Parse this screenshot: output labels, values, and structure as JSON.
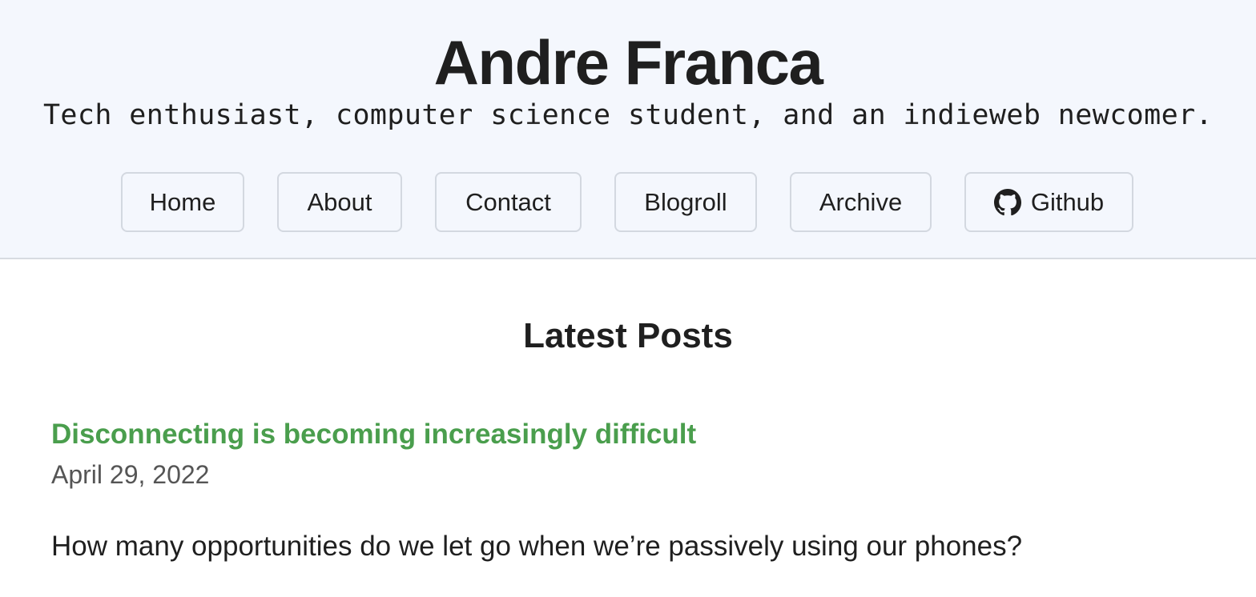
{
  "header": {
    "title": "Andre Franca",
    "tagline": "Tech enthusiast, computer science student, and an indieweb newcomer."
  },
  "nav": {
    "items": [
      {
        "label": "Home"
      },
      {
        "label": "About"
      },
      {
        "label": "Contact"
      },
      {
        "label": "Blogroll"
      },
      {
        "label": "Archive"
      },
      {
        "label": "Github",
        "icon": "github-icon"
      }
    ]
  },
  "main": {
    "section_title": "Latest Posts",
    "posts": [
      {
        "title": "Disconnecting is becoming increasingly difficult",
        "date": "April 29, 2022",
        "excerpt": "How many opportunities do we let go when we’re passively using our phones?"
      }
    ]
  },
  "colors": {
    "header_bg": "#f4f7fd",
    "link_green": "#4a9e4d",
    "border": "#d3d8e0"
  }
}
